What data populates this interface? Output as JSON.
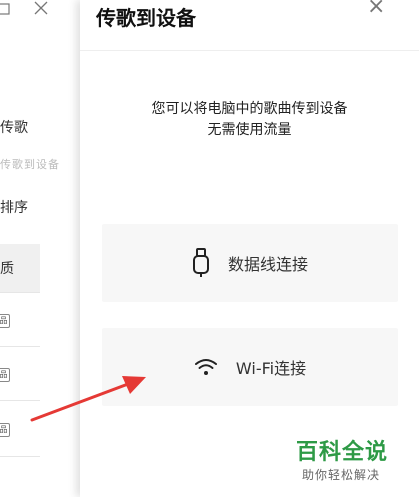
{
  "background_window": {
    "items": [
      "传歌",
      "排序",
      "质"
    ],
    "faded_text": "传歌到设备",
    "badge_glyph": "品"
  },
  "panel": {
    "title": "传歌到设备",
    "close_glyph": "×",
    "description_line1": "您可以将电脑中的歌曲传到设备",
    "description_line2": "无需使用流量",
    "cable_button_label": "数据线连接",
    "wifi_button_label": "Wi-Fi连接"
  },
  "watermark": {
    "title": "百科全说",
    "subtitle": "助你轻松解决"
  },
  "colors": {
    "annotation_arrow": "#e53935",
    "watermark": "#2e9a46"
  }
}
